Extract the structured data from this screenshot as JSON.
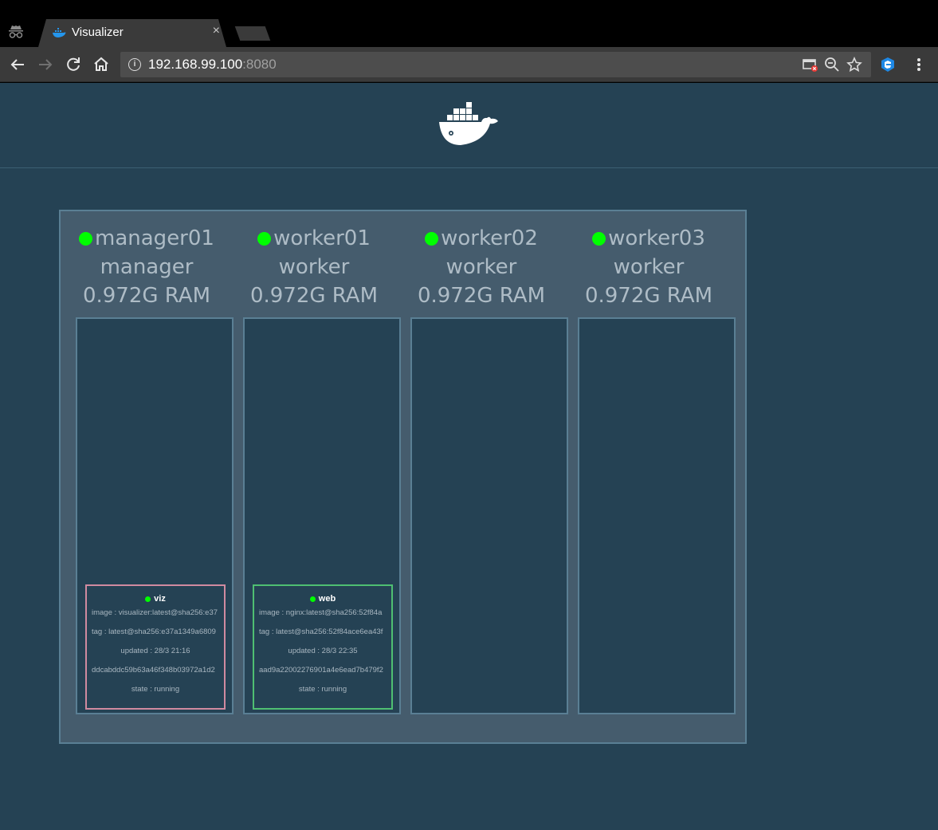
{
  "browser": {
    "tab_title": "Visualizer",
    "tab_close": "×",
    "url_host": "192.168.99.100",
    "url_port": ":8080"
  },
  "icons": {
    "incognito": "incognito-icon",
    "favicon": "docker-favicon-icon",
    "back": "back-arrow-icon",
    "forward": "forward-arrow-icon",
    "reload": "reload-icon",
    "home": "home-icon",
    "info": "info-icon",
    "blocked": "blocked-popup-icon",
    "zoom": "zoom-out-icon",
    "bookmark": "star-icon",
    "extension": "extension-icon",
    "menu": "kebab-menu-icon",
    "logo": "docker-logo-icon"
  },
  "colors": {
    "page_bg": "#254254",
    "cluster_bg": "#455c6d",
    "node_status": "#00ff00",
    "viz_border": "#d08aa0",
    "web_border": "#4fbf72"
  },
  "nodes": [
    {
      "name": "manager01",
      "role": "manager",
      "ram": "0.972G RAM"
    },
    {
      "name": "worker01",
      "role": "worker",
      "ram": "0.972G RAM"
    },
    {
      "name": "worker02",
      "role": "worker",
      "ram": "0.972G RAM"
    },
    {
      "name": "worker03",
      "role": "worker",
      "ram": "0.972G RAM"
    }
  ],
  "tasks": [
    {
      "name": "viz",
      "image": "image : visualizer:latest@sha256:e37",
      "tag": "tag : latest@sha256:e37a1349a6809",
      "updated": "updated : 28/3 21:16",
      "id": "ddcabddc59b63a46f348b03972a1d2",
      "state": "state : running"
    },
    {
      "name": "web",
      "image": "image : nginx:latest@sha256:52f84a",
      "tag": "tag : latest@sha256:52f84ace6ea43f",
      "updated": "updated : 28/3 22:35",
      "id": "aad9a22002276901a4e6ead7b479f2",
      "state": "state : running"
    }
  ]
}
